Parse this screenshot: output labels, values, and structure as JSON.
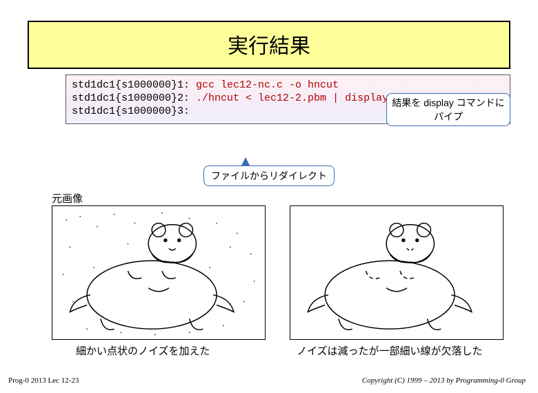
{
  "title": "実行結果",
  "callouts": {
    "pipe": "結果を display コマンドにパイプ",
    "redirect": "ファイルからリダイレクト"
  },
  "terminal": {
    "lines": [
      {
        "prompt": "std1dc1{s1000000}1: ",
        "cmd": "gcc lec12-nc.c -o hncut"
      },
      {
        "prompt": "std1dc1{s1000000}2: ",
        "cmd": "./hncut < lec12-2.pbm | display &"
      },
      {
        "prompt": "std1dc1{s1000000}3: ",
        "cmd": ""
      }
    ]
  },
  "labels": {
    "original": "元画像"
  },
  "captions": {
    "left": "細かい点状のノイズを加えた",
    "right": "ノイズは減ったが一部細い線が欠落した"
  },
  "footer": {
    "left": "Prog-0 2013 Lec 12-23",
    "right": "Copyright (C) 1999 – 2013 by Programming-0 Group"
  }
}
